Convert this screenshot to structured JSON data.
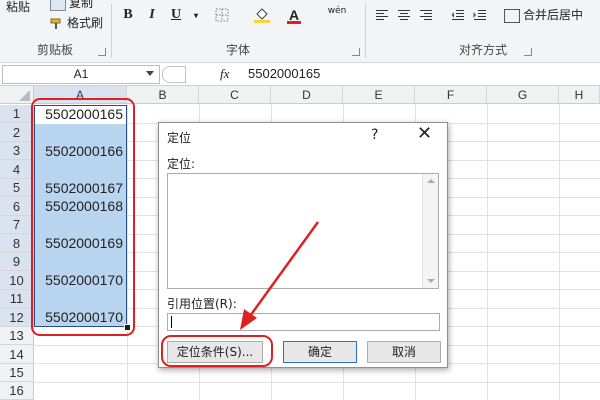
{
  "ribbon": {
    "clipboard": {
      "paste_label": "粘贴",
      "copy_label": "复制",
      "format_painter_label": "格式刷",
      "group_caption": "剪贴板"
    },
    "font": {
      "bold": "B",
      "italic": "I",
      "underline": "U",
      "font_color_glyph": "A",
      "wen_glyph": "wén",
      "group_caption": "字体"
    },
    "alignment": {
      "merge_center_label": "合并后居中",
      "group_caption": "对齐方式"
    },
    "colors": {
      "highlight": "#f6d43a",
      "font_red": "#e02020"
    }
  },
  "formula_bar": {
    "name_box": "A1",
    "fx": "fx",
    "value": "5502000165"
  },
  "sheet": {
    "columns": [
      "A",
      "B",
      "C",
      "D",
      "E",
      "F",
      "G",
      "H"
    ],
    "rows": [
      "1",
      "2",
      "3",
      "4",
      "5",
      "6",
      "7",
      "8",
      "9",
      "10",
      "11",
      "12",
      "13",
      "14",
      "15",
      "16"
    ],
    "cells_A": [
      "5502000165",
      "5502000166",
      "5502000167",
      "5502000168",
      "5502000169",
      "5502000170",
      "5502000170"
    ],
    "selection_color": "#b8d4ee"
  },
  "dialog": {
    "title": "定位",
    "help": "?",
    "close": "✕",
    "goto_label": "定位:",
    "reference_label": "引用位置(R):",
    "reference_value": "",
    "special_button": "定位条件(S)...",
    "ok_button": "确定",
    "cancel_button": "取消"
  },
  "annotation_color": "#e02020"
}
